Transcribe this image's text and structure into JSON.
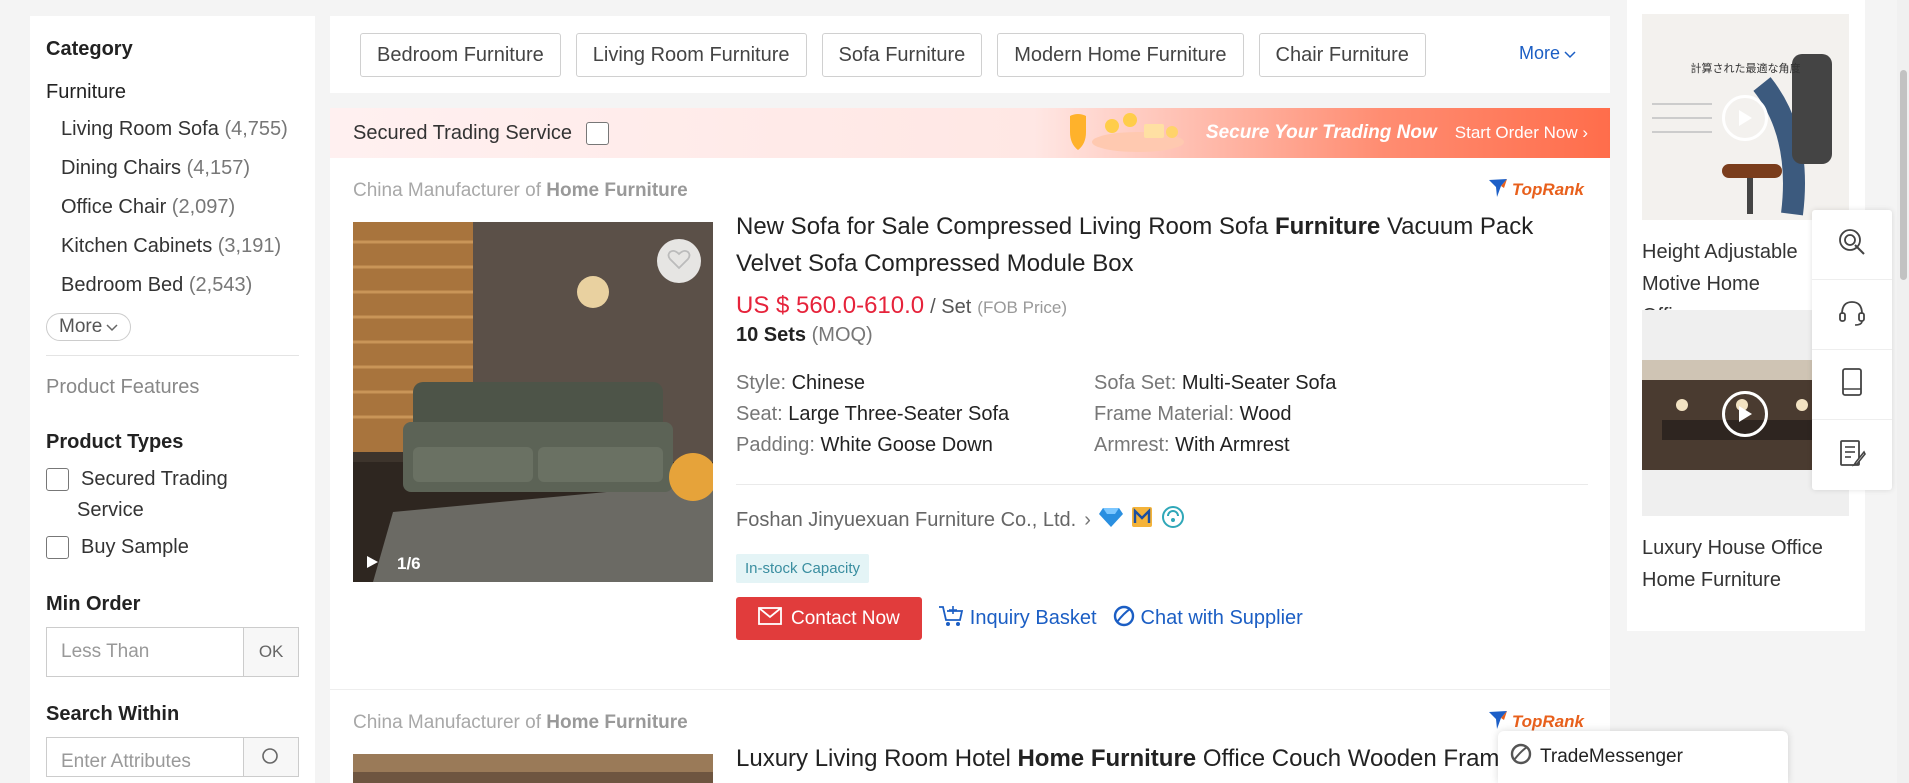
{
  "sidebar": {
    "category_heading": "Category",
    "category_root": "Furniture",
    "categories": [
      {
        "name": "Living Room Sofa",
        "count": "(4,755)"
      },
      {
        "name": "Dining Chairs",
        "count": "(4,157)"
      },
      {
        "name": "Office Chair",
        "count": "(2,097)"
      },
      {
        "name": "Kitchen Cabinets",
        "count": "(3,191)"
      },
      {
        "name": "Bedroom Bed",
        "count": "(2,543)"
      }
    ],
    "more_label": "More",
    "product_features": "Product Features",
    "product_types_heading": "Product Types",
    "product_types": [
      "Secured Trading Service",
      "Buy Sample"
    ],
    "min_order_heading": "Min Order",
    "min_order_placeholder": "Less Than",
    "min_order_ok": "OK",
    "search_within_heading": "Search Within",
    "search_within_placeholder": "Enter Attributes"
  },
  "top_categories": [
    "Bedroom Furniture",
    "Living Room Furniture",
    "Sofa Furniture",
    "Modern Home Furniture",
    "Chair Furniture"
  ],
  "top_more": "More",
  "banner": {
    "label": "Secured Trading Service",
    "slogan": "Secure Your Trading Now",
    "cta": "Start Order Now"
  },
  "products": [
    {
      "mfr_prefix": "China Manufacturer of",
      "mfr_bold": "Home Furniture",
      "rank_label": "TopRank",
      "title_pre": "New Sofa for Sale Compressed Living Room Sofa",
      "title_bold": "Furniture",
      "title_post": "Vacuum Pack Velvet Sofa Compressed Module Box",
      "price": "US $ 560.0-610.0",
      "unit": "/ Set",
      "price_note": "(FOB Price)",
      "moq_value": "10 Sets",
      "moq_note": "(MOQ)",
      "image_counter": "1/6",
      "attributes": [
        {
          "k": "Style:",
          "v": "Chinese"
        },
        {
          "k": "Sofa Set:",
          "v": "Multi-Seater Sofa"
        },
        {
          "k": "Seat:",
          "v": "Large Three-Seater Sofa"
        },
        {
          "k": "Frame Material:",
          "v": "Wood"
        },
        {
          "k": "Padding:",
          "v": "White Goose Down"
        },
        {
          "k": "Armrest:",
          "v": "With Armrest"
        }
      ],
      "supplier": "Foshan Jinyuexuan Furniture Co., Ltd.",
      "badge": "In-stock Capacity",
      "contact": "Contact Now",
      "inquiry": "Inquiry Basket",
      "chat": "Chat with Supplier"
    },
    {
      "mfr_prefix": "China Manufacturer of",
      "mfr_bold": "Home Furniture",
      "rank_label": "TopRank",
      "title_pre": "Luxury Living Room Hotel",
      "title_bold": "Home Furniture",
      "title_post": "Office Couch Wooden Frame"
    }
  ],
  "right_column": [
    {
      "title": "Height Adjustable Motive Home Office"
    },
    {
      "title": "Luxury House Office Home Furniture"
    }
  ],
  "right_image_caption": "計算された最適な角度",
  "trade_messenger": "TradeMessenger",
  "colors": {
    "price": "#e6233b",
    "contact_button": "#e13c3c",
    "link": "#1b5ec4",
    "rank": "#e8601c"
  }
}
